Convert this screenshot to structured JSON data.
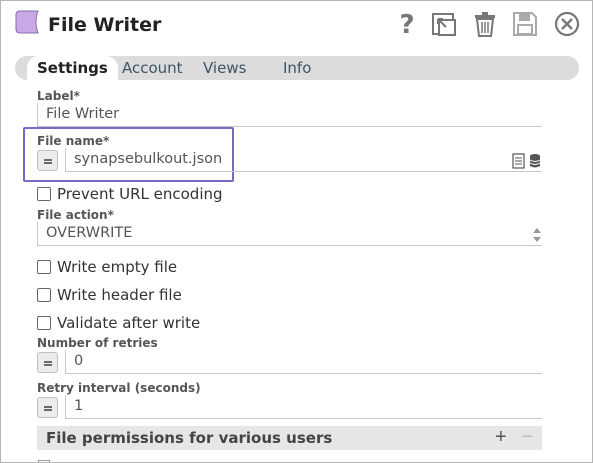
{
  "header": {
    "title": "File Writer",
    "icons": [
      "help-icon",
      "export-icon",
      "trash-icon",
      "save-icon",
      "close-icon"
    ],
    "accent_color": "#c9a8e6"
  },
  "tabs": [
    {
      "label": "Settings",
      "active": true
    },
    {
      "label": "Account",
      "active": false
    },
    {
      "label": "Views",
      "active": false
    },
    {
      "label": "Info",
      "active": false
    }
  ],
  "form": {
    "label": {
      "title": "Label*",
      "value": "File Writer"
    },
    "file_name": {
      "title": "File name*",
      "value": "synapsebulkout.json"
    },
    "prevent_url_encoding": {
      "label": "Prevent URL encoding",
      "checked": false
    },
    "file_action": {
      "title": "File action*",
      "value": "OVERWRITE"
    },
    "write_empty_file": {
      "label": "Write empty file",
      "checked": false
    },
    "write_header_file": {
      "label": "Write header file",
      "checked": false
    },
    "validate_after_write": {
      "label": "Validate after write",
      "checked": false
    },
    "number_of_retries": {
      "title": "Number of retries",
      "value": "0"
    },
    "retry_interval": {
      "title": "Retry interval (seconds)",
      "value": "1"
    }
  },
  "permissions": {
    "title": "File permissions for various users",
    "add": "+",
    "remove": "−"
  }
}
